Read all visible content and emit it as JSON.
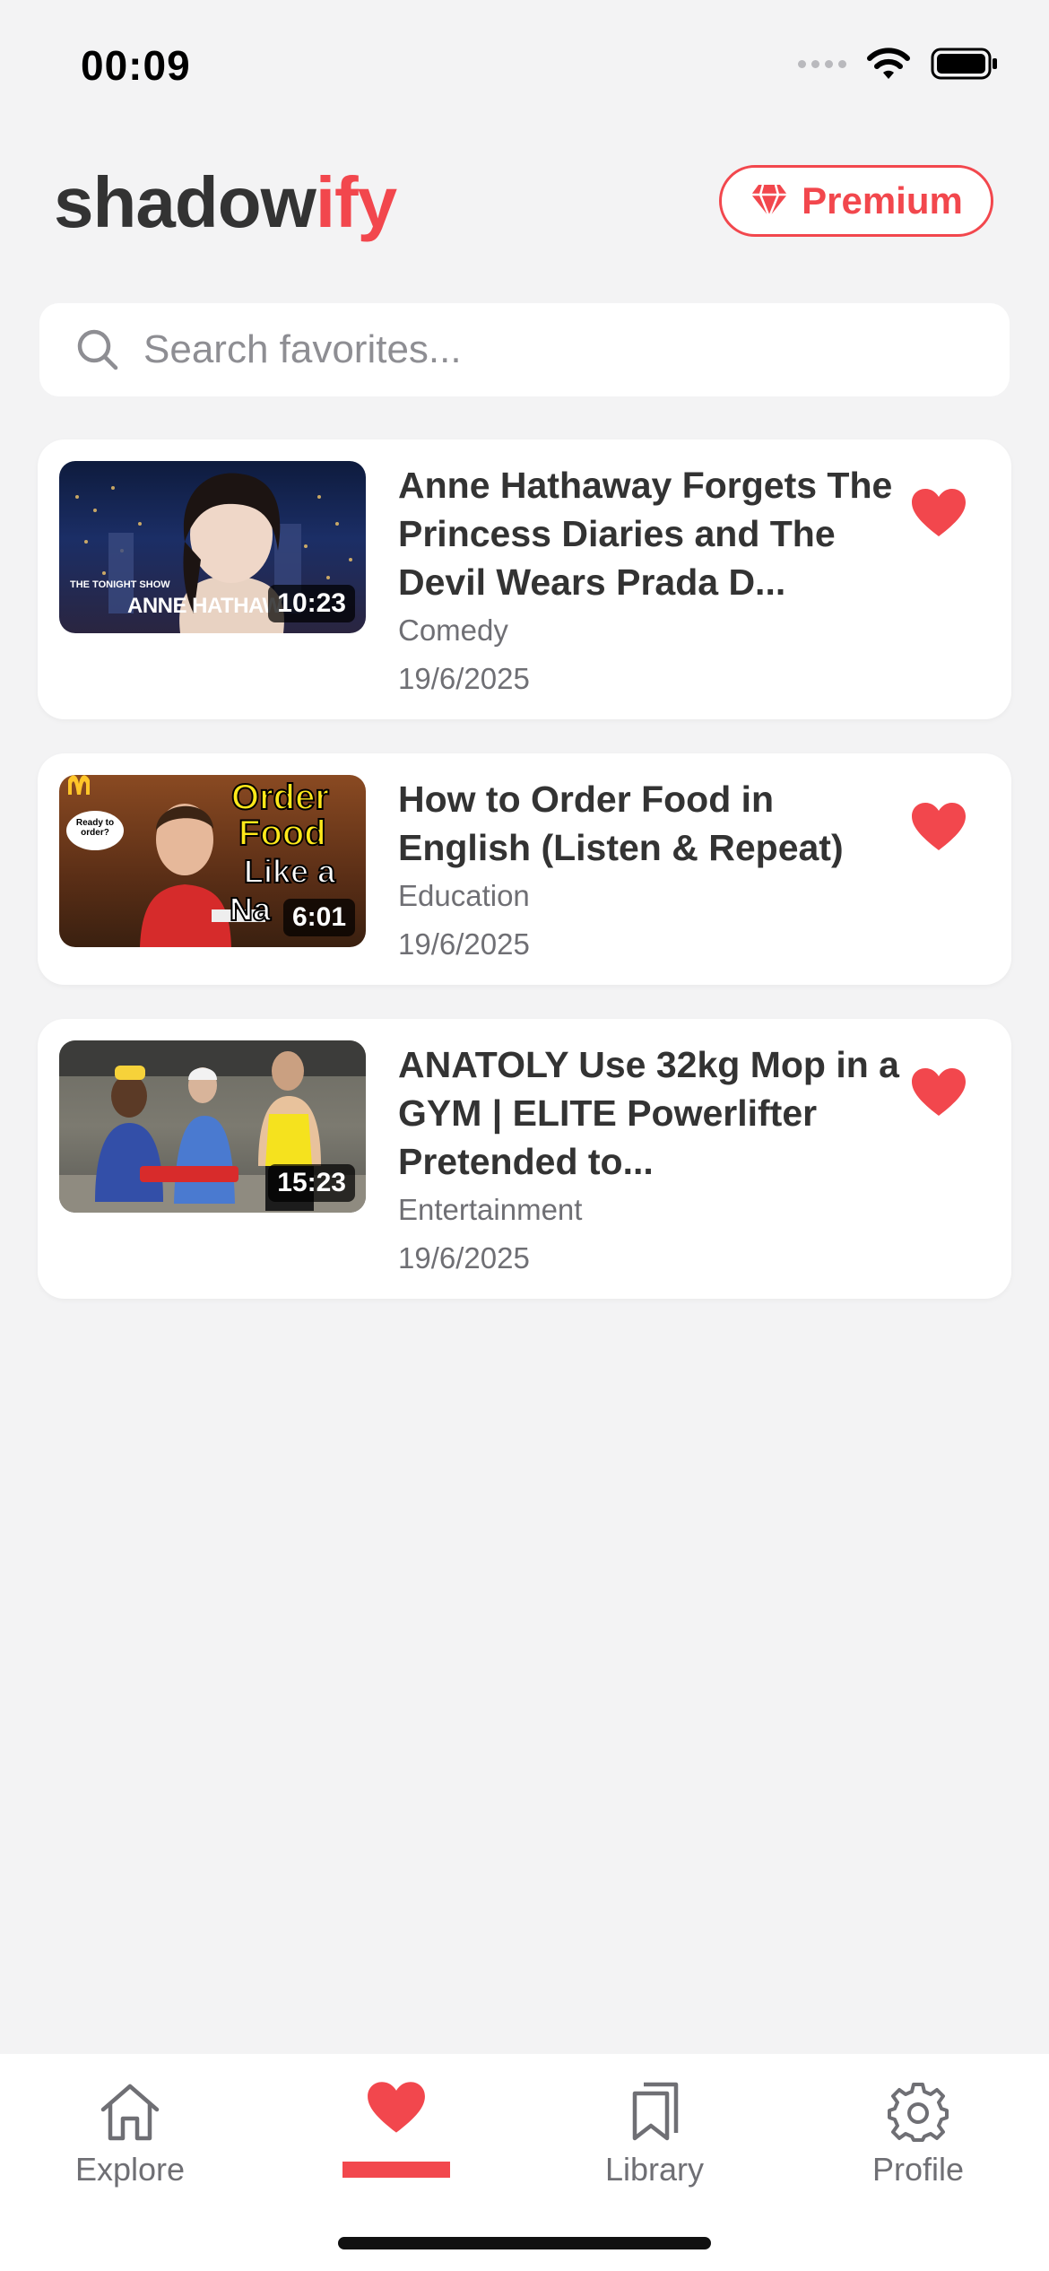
{
  "status_bar": {
    "time": "00:09"
  },
  "header": {
    "brand_part1": "shadow",
    "brand_part2": "ify",
    "premium_label": "Premium"
  },
  "search": {
    "placeholder": "Search favorites..."
  },
  "videos": [
    {
      "title": "Anne Hathaway Forgets The Princess Diaries and The Devil Wears Prada D...",
      "category": "Comedy",
      "date": "19/6/2025",
      "duration": "10:23",
      "thumb_text": "ANNE HATHAW",
      "thumb_small": "THE TONIGHT SHOW"
    },
    {
      "title": "How to Order Food in English (Listen & Repeat)",
      "category": "Education",
      "date": "19/6/2025",
      "duration": "6:01",
      "thumb_line1": "Order",
      "thumb_line2": "Food",
      "thumb_line3": "Like a",
      "thumb_line4": "Na",
      "thumb_bubble": "Ready to order?"
    },
    {
      "title": "ANATOLY Use 32kg Mop in a GYM | ELITE Powerlifter Pretended to...",
      "category": "Entertainment",
      "date": "19/6/2025",
      "duration": "15:23"
    }
  ],
  "nav": {
    "items": [
      {
        "label": "Explore",
        "icon": "home-icon"
      },
      {
        "label": "",
        "icon": "heart-icon"
      },
      {
        "label": "Library",
        "icon": "bookmark-icon"
      },
      {
        "label": "Profile",
        "icon": "gear-icon"
      }
    ]
  },
  "colors": {
    "accent": "#f2474d",
    "background": "#f3f3f4",
    "text": "#333333",
    "muted": "#6f6f74"
  }
}
